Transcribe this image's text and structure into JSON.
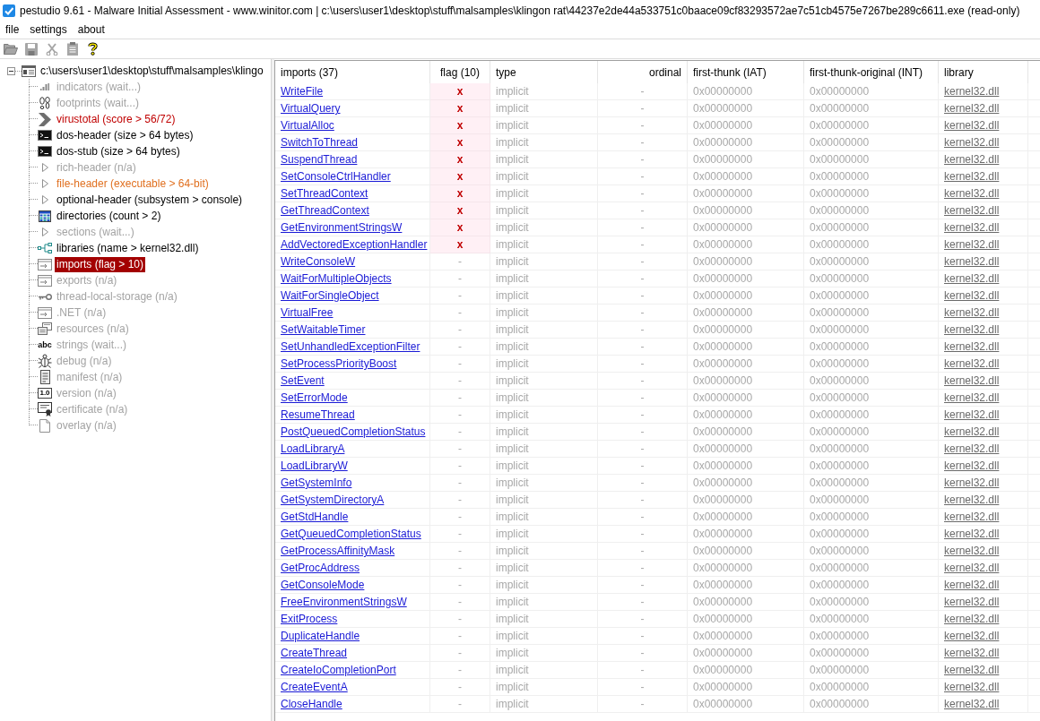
{
  "window": {
    "title": "pestudio 9.61 - Malware Initial Assessment - www.winitor.com | c:\\users\\user1\\desktop\\stuff\\malsamples\\klingon rat\\44237e2de44a533751c0baace09cf83293572ae7c51cb4575e7267be289c6611.exe (read-only)"
  },
  "menu": [
    "file",
    "settings",
    "about"
  ],
  "toolbar": [
    {
      "disabled": true
    },
    {
      "disabled": true
    },
    {
      "disabled": true
    },
    {
      "disabled": true
    },
    {
      "disabled": false
    }
  ],
  "tree": {
    "label": "c:\\users\\user1\\desktop\\stuff\\malsamples\\klingo",
    "expanded": true,
    "children": [
      {
        "label": "indicators (wait...)",
        "disabled": true,
        "selected": false
      },
      {
        "label": "footprints (wait...)",
        "disabled": true,
        "selected": false
      },
      {
        "label": "virustotal (score > 56/72)",
        "disabled": false,
        "selected": false,
        "color": "#c00000"
      },
      {
        "label": "dos-header (size > 64 bytes)",
        "disabled": false,
        "selected": false
      },
      {
        "label": "dos-stub (size > 64 bytes)",
        "disabled": false,
        "selected": false
      },
      {
        "label": "rich-header (n/a)",
        "disabled": true,
        "selected": false
      },
      {
        "label": "file-header (executable > 64-bit)",
        "disabled": false,
        "selected": false,
        "color": "#e07020"
      },
      {
        "label": "optional-header (subsystem > console)",
        "disabled": false,
        "selected": false
      },
      {
        "label": "directories (count > 2)",
        "disabled": false,
        "selected": false
      },
      {
        "label": "sections (wait...)",
        "disabled": true,
        "selected": false
      },
      {
        "label": "libraries (name > kernel32.dll)",
        "disabled": false,
        "selected": false
      },
      {
        "label": "imports (flag > 10)",
        "disabled": false,
        "selected": true
      },
      {
        "label": "exports (n/a)",
        "disabled": true,
        "selected": false
      },
      {
        "label": "thread-local-storage (n/a)",
        "disabled": true,
        "selected": false
      },
      {
        "label": ".NET (n/a)",
        "disabled": true,
        "selected": false
      },
      {
        "label": "resources (n/a)",
        "disabled": true,
        "selected": false
      },
      {
        "label": "strings (wait...)",
        "disabled": true,
        "selected": false,
        "icon_text": "abc"
      },
      {
        "label": "debug (n/a)",
        "disabled": true,
        "selected": false
      },
      {
        "label": "manifest (n/a)",
        "disabled": true,
        "selected": false
      },
      {
        "label": "version (n/a)",
        "disabled": true,
        "selected": false,
        "icon_text": "1.0"
      },
      {
        "label": "certificate (n/a)",
        "disabled": true,
        "selected": false
      },
      {
        "label": "overlay (n/a)",
        "disabled": true,
        "selected": false
      }
    ]
  },
  "table": {
    "columns": [
      "imports (37)",
      "flag (10)",
      "type",
      "ordinal",
      "first-thunk (IAT)",
      "first-thunk-original (INT)",
      "library"
    ],
    "rows": [
      {
        "name": "WriteFile",
        "flag": "x",
        "flagged": true,
        "type": "implicit",
        "ordinal": "-",
        "first_thunk": "0x00000000",
        "first_thunk_original": "0x00000000",
        "library": "kernel32.dll"
      },
      {
        "name": "VirtualQuery",
        "flag": "x",
        "flagged": true,
        "type": "implicit",
        "ordinal": "-",
        "first_thunk": "0x00000000",
        "first_thunk_original": "0x00000000",
        "library": "kernel32.dll"
      },
      {
        "name": "VirtualAlloc",
        "flag": "x",
        "flagged": true,
        "type": "implicit",
        "ordinal": "-",
        "first_thunk": "0x00000000",
        "first_thunk_original": "0x00000000",
        "library": "kernel32.dll"
      },
      {
        "name": "SwitchToThread",
        "flag": "x",
        "flagged": true,
        "type": "implicit",
        "ordinal": "-",
        "first_thunk": "0x00000000",
        "first_thunk_original": "0x00000000",
        "library": "kernel32.dll"
      },
      {
        "name": "SuspendThread",
        "flag": "x",
        "flagged": true,
        "type": "implicit",
        "ordinal": "-",
        "first_thunk": "0x00000000",
        "first_thunk_original": "0x00000000",
        "library": "kernel32.dll"
      },
      {
        "name": "SetConsoleCtrlHandler",
        "flag": "x",
        "flagged": true,
        "type": "implicit",
        "ordinal": "-",
        "first_thunk": "0x00000000",
        "first_thunk_original": "0x00000000",
        "library": "kernel32.dll"
      },
      {
        "name": "SetThreadContext",
        "flag": "x",
        "flagged": true,
        "type": "implicit",
        "ordinal": "-",
        "first_thunk": "0x00000000",
        "first_thunk_original": "0x00000000",
        "library": "kernel32.dll"
      },
      {
        "name": "GetThreadContext",
        "flag": "x",
        "flagged": true,
        "type": "implicit",
        "ordinal": "-",
        "first_thunk": "0x00000000",
        "first_thunk_original": "0x00000000",
        "library": "kernel32.dll"
      },
      {
        "name": "GetEnvironmentStringsW",
        "flag": "x",
        "flagged": true,
        "type": "implicit",
        "ordinal": "-",
        "first_thunk": "0x00000000",
        "first_thunk_original": "0x00000000",
        "library": "kernel32.dll"
      },
      {
        "name": "AddVectoredExceptionHandler",
        "flag": "x",
        "flagged": true,
        "type": "implicit",
        "ordinal": "-",
        "first_thunk": "0x00000000",
        "first_thunk_original": "0x00000000",
        "library": "kernel32.dll"
      },
      {
        "name": "WriteConsoleW",
        "flag": "-",
        "flagged": false,
        "type": "implicit",
        "ordinal": "-",
        "first_thunk": "0x00000000",
        "first_thunk_original": "0x00000000",
        "library": "kernel32.dll"
      },
      {
        "name": "WaitForMultipleObjects",
        "flag": "-",
        "flagged": false,
        "type": "implicit",
        "ordinal": "-",
        "first_thunk": "0x00000000",
        "first_thunk_original": "0x00000000",
        "library": "kernel32.dll"
      },
      {
        "name": "WaitForSingleObject",
        "flag": "-",
        "flagged": false,
        "type": "implicit",
        "ordinal": "-",
        "first_thunk": "0x00000000",
        "first_thunk_original": "0x00000000",
        "library": "kernel32.dll"
      },
      {
        "name": "VirtualFree",
        "flag": "-",
        "flagged": false,
        "type": "implicit",
        "ordinal": "-",
        "first_thunk": "0x00000000",
        "first_thunk_original": "0x00000000",
        "library": "kernel32.dll"
      },
      {
        "name": "SetWaitableTimer",
        "flag": "-",
        "flagged": false,
        "type": "implicit",
        "ordinal": "-",
        "first_thunk": "0x00000000",
        "first_thunk_original": "0x00000000",
        "library": "kernel32.dll"
      },
      {
        "name": "SetUnhandledExceptionFilter",
        "flag": "-",
        "flagged": false,
        "type": "implicit",
        "ordinal": "-",
        "first_thunk": "0x00000000",
        "first_thunk_original": "0x00000000",
        "library": "kernel32.dll"
      },
      {
        "name": "SetProcessPriorityBoost",
        "flag": "-",
        "flagged": false,
        "type": "implicit",
        "ordinal": "-",
        "first_thunk": "0x00000000",
        "first_thunk_original": "0x00000000",
        "library": "kernel32.dll"
      },
      {
        "name": "SetEvent",
        "flag": "-",
        "flagged": false,
        "type": "implicit",
        "ordinal": "-",
        "first_thunk": "0x00000000",
        "first_thunk_original": "0x00000000",
        "library": "kernel32.dll"
      },
      {
        "name": "SetErrorMode",
        "flag": "-",
        "flagged": false,
        "type": "implicit",
        "ordinal": "-",
        "first_thunk": "0x00000000",
        "first_thunk_original": "0x00000000",
        "library": "kernel32.dll"
      },
      {
        "name": "ResumeThread",
        "flag": "-",
        "flagged": false,
        "type": "implicit",
        "ordinal": "-",
        "first_thunk": "0x00000000",
        "first_thunk_original": "0x00000000",
        "library": "kernel32.dll"
      },
      {
        "name": "PostQueuedCompletionStatus",
        "flag": "-",
        "flagged": false,
        "type": "implicit",
        "ordinal": "-",
        "first_thunk": "0x00000000",
        "first_thunk_original": "0x00000000",
        "library": "kernel32.dll"
      },
      {
        "name": "LoadLibraryA",
        "flag": "-",
        "flagged": false,
        "type": "implicit",
        "ordinal": "-",
        "first_thunk": "0x00000000",
        "first_thunk_original": "0x00000000",
        "library": "kernel32.dll"
      },
      {
        "name": "LoadLibraryW",
        "flag": "-",
        "flagged": false,
        "type": "implicit",
        "ordinal": "-",
        "first_thunk": "0x00000000",
        "first_thunk_original": "0x00000000",
        "library": "kernel32.dll"
      },
      {
        "name": "GetSystemInfo",
        "flag": "-",
        "flagged": false,
        "type": "implicit",
        "ordinal": "-",
        "first_thunk": "0x00000000",
        "first_thunk_original": "0x00000000",
        "library": "kernel32.dll"
      },
      {
        "name": "GetSystemDirectoryA",
        "flag": "-",
        "flagged": false,
        "type": "implicit",
        "ordinal": "-",
        "first_thunk": "0x00000000",
        "first_thunk_original": "0x00000000",
        "library": "kernel32.dll"
      },
      {
        "name": "GetStdHandle",
        "flag": "-",
        "flagged": false,
        "type": "implicit",
        "ordinal": "-",
        "first_thunk": "0x00000000",
        "first_thunk_original": "0x00000000",
        "library": "kernel32.dll"
      },
      {
        "name": "GetQueuedCompletionStatus",
        "flag": "-",
        "flagged": false,
        "type": "implicit",
        "ordinal": "-",
        "first_thunk": "0x00000000",
        "first_thunk_original": "0x00000000",
        "library": "kernel32.dll"
      },
      {
        "name": "GetProcessAffinityMask",
        "flag": "-",
        "flagged": false,
        "type": "implicit",
        "ordinal": "-",
        "first_thunk": "0x00000000",
        "first_thunk_original": "0x00000000",
        "library": "kernel32.dll"
      },
      {
        "name": "GetProcAddress",
        "flag": "-",
        "flagged": false,
        "type": "implicit",
        "ordinal": "-",
        "first_thunk": "0x00000000",
        "first_thunk_original": "0x00000000",
        "library": "kernel32.dll"
      },
      {
        "name": "GetConsoleMode",
        "flag": "-",
        "flagged": false,
        "type": "implicit",
        "ordinal": "-",
        "first_thunk": "0x00000000",
        "first_thunk_original": "0x00000000",
        "library": "kernel32.dll"
      },
      {
        "name": "FreeEnvironmentStringsW",
        "flag": "-",
        "flagged": false,
        "type": "implicit",
        "ordinal": "-",
        "first_thunk": "0x00000000",
        "first_thunk_original": "0x00000000",
        "library": "kernel32.dll"
      },
      {
        "name": "ExitProcess",
        "flag": "-",
        "flagged": false,
        "type": "implicit",
        "ordinal": "-",
        "first_thunk": "0x00000000",
        "first_thunk_original": "0x00000000",
        "library": "kernel32.dll"
      },
      {
        "name": "DuplicateHandle",
        "flag": "-",
        "flagged": false,
        "type": "implicit",
        "ordinal": "-",
        "first_thunk": "0x00000000",
        "first_thunk_original": "0x00000000",
        "library": "kernel32.dll"
      },
      {
        "name": "CreateThread",
        "flag": "-",
        "flagged": false,
        "type": "implicit",
        "ordinal": "-",
        "first_thunk": "0x00000000",
        "first_thunk_original": "0x00000000",
        "library": "kernel32.dll"
      },
      {
        "name": "CreateIoCompletionPort",
        "flag": "-",
        "flagged": false,
        "type": "implicit",
        "ordinal": "-",
        "first_thunk": "0x00000000",
        "first_thunk_original": "0x00000000",
        "library": "kernel32.dll"
      },
      {
        "name": "CreateEventA",
        "flag": "-",
        "flagged": false,
        "type": "implicit",
        "ordinal": "-",
        "first_thunk": "0x00000000",
        "first_thunk_original": "0x00000000",
        "library": "kernel32.dll"
      },
      {
        "name": "CloseHandle",
        "flag": "-",
        "flagged": false,
        "type": "implicit",
        "ordinal": "-",
        "first_thunk": "0x00000000",
        "first_thunk_original": "0x00000000",
        "library": "kernel32.dll"
      }
    ]
  }
}
